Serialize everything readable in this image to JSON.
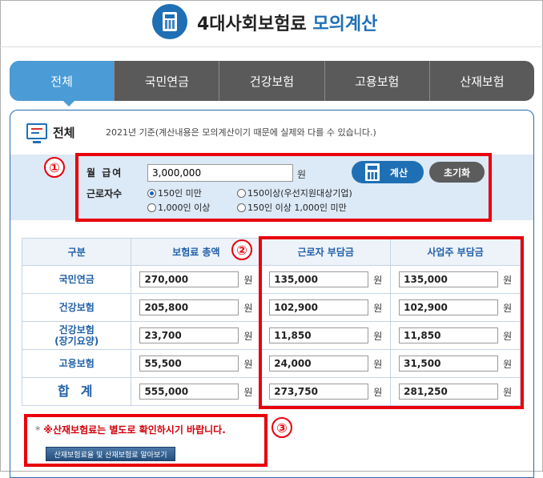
{
  "header": {
    "title_main": "4대사회보험료",
    "title_accent": "모의계산"
  },
  "tabs": [
    {
      "label": "전체",
      "active": true
    },
    {
      "label": "국민연금",
      "active": false
    },
    {
      "label": "건강보험",
      "active": false
    },
    {
      "label": "고용보험",
      "active": false
    },
    {
      "label": "산재보험",
      "active": false
    }
  ],
  "section": {
    "title": "전체",
    "notice": "2021년 기준(계산내용은 모의계산이기 때문에 실제와 다를 수 있습니다.)"
  },
  "form": {
    "salary_label": "월 급여",
    "salary_value": "3,000,000",
    "salary_unit": "원",
    "workers_label": "근로자수",
    "options": [
      {
        "label": "150인 미만",
        "checked": true
      },
      {
        "label": "150이상(우선지원대상기업)",
        "checked": false
      },
      {
        "label": "1,000인 이상",
        "checked": false
      },
      {
        "label": "150인 이상 1,000인 미만",
        "checked": false
      }
    ],
    "calc_button": "계산",
    "reset_button": "초기화"
  },
  "table": {
    "headers": [
      "구분",
      "보험료 총액",
      "근로자 부담금",
      "사업주 부담금"
    ],
    "unit": "원",
    "rows": [
      {
        "name": "국민연금",
        "values": [
          "270,000",
          "135,000",
          "135,000"
        ]
      },
      {
        "name": "건강보험",
        "values": [
          "205,800",
          "102,900",
          "102,900"
        ]
      },
      {
        "name": "건강보험\n(장기요양)",
        "name1": "건강보험",
        "name2": "(장기요양)",
        "values": [
          "23,700",
          "11,850",
          "11,850"
        ]
      },
      {
        "name": "고용보험",
        "values": [
          "55,500",
          "24,000",
          "31,500"
        ]
      },
      {
        "name": "합계",
        "values": [
          "555,000",
          "273,750",
          "281,250"
        ]
      }
    ]
  },
  "callouts": [
    "①",
    "②",
    "③"
  ],
  "footer": {
    "bullet": "*",
    "warning": "※산재보험료는 별도로 확인하시기 바랍니다.",
    "link_button": "산재보험료율 및 산재보험료 알아보기"
  },
  "colors": {
    "brand_blue": "#1f6fb5",
    "tab_active": "#4a9bd6",
    "tab_inactive": "#5a5a5a",
    "highlight_red": "#e8000b"
  }
}
